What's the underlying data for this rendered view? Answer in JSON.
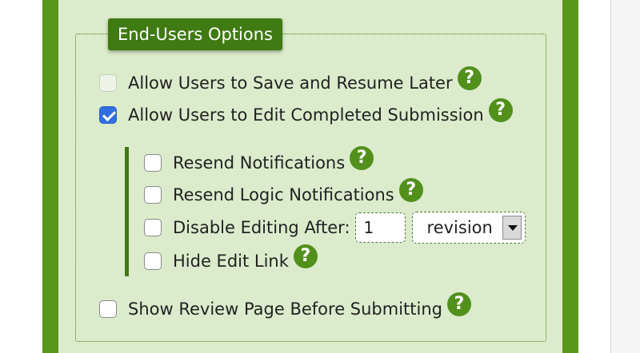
{
  "section": {
    "legend": "End-Users Options"
  },
  "options": {
    "save_resume": {
      "label": "Allow Users to Save and Resume Later",
      "checked": false,
      "disabled": true
    },
    "edit_completed": {
      "label": "Allow Users to Edit Completed Submission",
      "checked": true
    },
    "resend_notifications": {
      "label": "Resend Notifications",
      "checked": false
    },
    "resend_logic": {
      "label": "Resend Logic Notifications",
      "checked": false
    },
    "disable_editing": {
      "label": "Disable Editing After:",
      "checked": false,
      "count_value": "1",
      "unit_value": "revision"
    },
    "hide_edit_link": {
      "label": "Hide Edit Link",
      "checked": false
    },
    "review_page": {
      "label": "Show Review Page Before Submitting",
      "checked": false
    }
  },
  "help_glyph": "?",
  "colors": {
    "border_green": "#5a9618",
    "panel_bg": "#dcebcc",
    "legend_bg": "#3f7a12",
    "help_bg": "#52901c",
    "checkbox_checked": "#2f6fe0"
  }
}
